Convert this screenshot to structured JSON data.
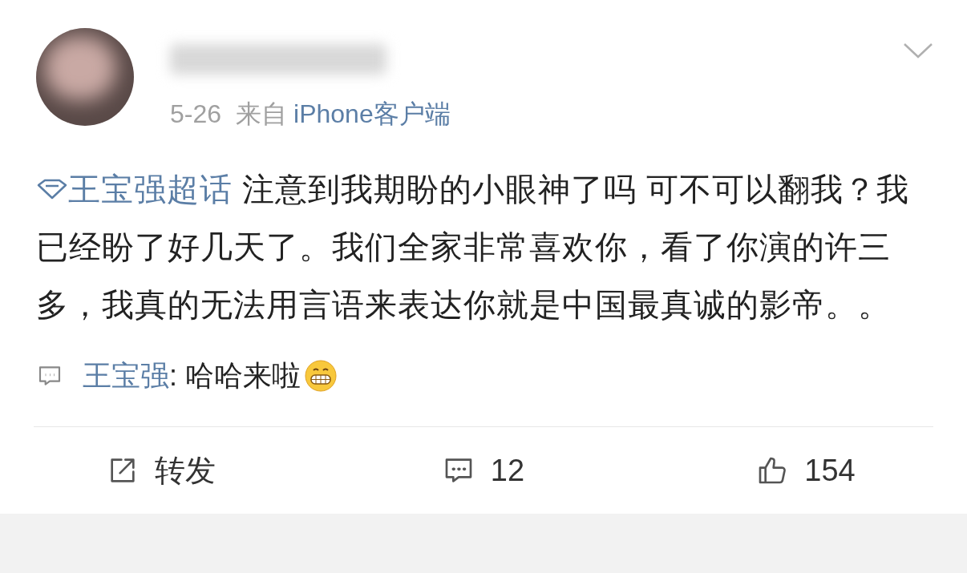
{
  "header": {
    "date": "5-26",
    "source_prefix": "来自",
    "source": "iPhone客户端"
  },
  "post": {
    "topic": "王宝强超话",
    "text": " 注意到我期盼的小眼神了吗 可不可以翻我？我已经盼了好几天了。我们全家非常喜欢你，看了你演的许三多，我真的无法用言语来表达你就是中国最真诚的影帝。。"
  },
  "reply": {
    "author": "王宝强",
    "text": ": 哈哈来啦"
  },
  "actions": [
    {
      "kind": "repost",
      "label": "转发"
    },
    {
      "kind": "comment",
      "label": "12"
    },
    {
      "kind": "like",
      "label": "154"
    }
  ]
}
